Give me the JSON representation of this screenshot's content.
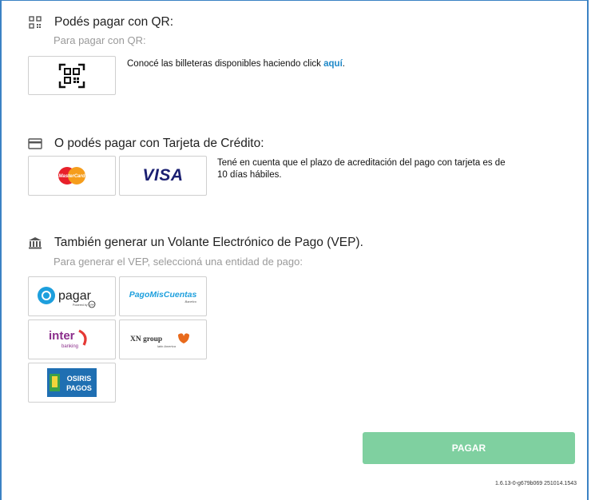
{
  "qr": {
    "title": "Podés pagar con QR:",
    "subtitle": "Para pagar con QR:",
    "note_text": "Conocé las billeteras disponibles haciendo click ",
    "note_link": "aquí",
    "note_end": "."
  },
  "card": {
    "title": "O podés pagar con Tarjeta de Crédito:",
    "note_line1": "Tené en cuenta que el plazo de acreditación del pago con tarjeta es de",
    "note_line2": "10 días hábiles.",
    "mastercard": "MasterCard",
    "visa": "VISA"
  },
  "vep": {
    "title": "También generar un Volante Electrónico de Pago (VEP).",
    "subtitle": "Para generar el VEP, seleccioná una entidad de pago:",
    "pagar": "pagar",
    "pagar_small": "Powered by",
    "pagar_badge": "LINK",
    "pmc": "PagoMisCuentas",
    "pmc_small": "Banelco",
    "inter": "inter",
    "inter_small": "banking",
    "xn": "XN group",
    "xn_small": "latin America",
    "osiris1": "OSIRIS",
    "osiris2": "PAGOS"
  },
  "pay_button": "PAGAR",
  "version": "1.6.13-0-g679b069 251014.1543",
  "colors": {
    "accent": "#1e88c8",
    "button": "#7fd0a0",
    "frame": "#3b82c4"
  }
}
